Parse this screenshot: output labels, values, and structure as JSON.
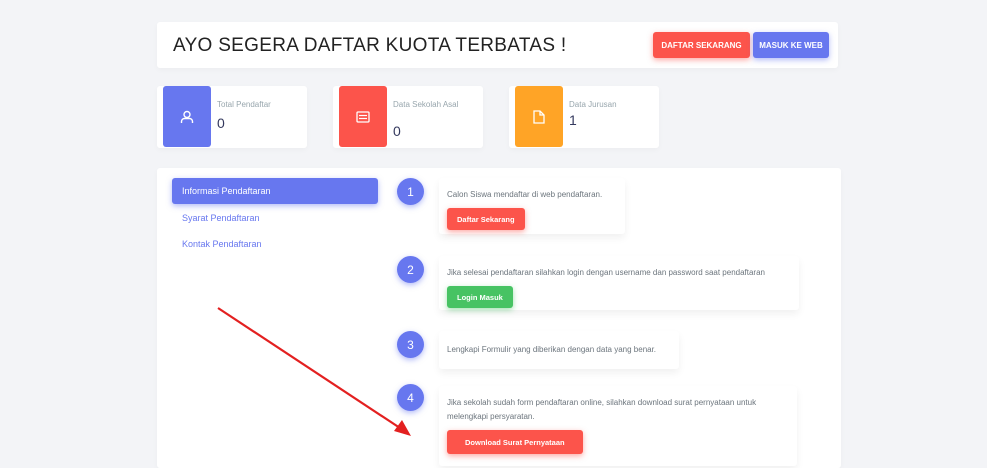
{
  "header": {
    "title": "AYO SEGERA DAFTAR KUOTA TERBATAS !",
    "daftar_button": "DAFTAR SEKARANG",
    "masuk_button": "MASUK KE WEB"
  },
  "stats": [
    {
      "label": "Total Pendaftar",
      "value": "0",
      "icon": "user-icon",
      "color": "#6777ef"
    },
    {
      "label": "Data Sekolah Asal",
      "value": "0",
      "icon": "school-card-icon",
      "color": "#fc544b"
    },
    {
      "label": "Data Jurusan",
      "value": "1",
      "icon": "file-icon",
      "color": "#ffa426"
    }
  ],
  "sidebar": {
    "items": [
      {
        "label": "Informasi Pendaftaran",
        "active": true
      },
      {
        "label": "Syarat Pendaftaran",
        "active": false
      },
      {
        "label": "Kontak Pendaftaran",
        "active": false
      }
    ]
  },
  "steps": [
    {
      "number": "1",
      "text": "Calon Siswa mendaftar di web pendaftaran.",
      "button": "Daftar Sekarang"
    },
    {
      "number": "2",
      "text": "Jika selesai pendaftaran silahkan login dengan username dan password saat pendaftaran",
      "button": "Login Masuk"
    },
    {
      "number": "3",
      "text": "Lengkapi Formulir yang diberikan dengan data yang benar."
    },
    {
      "number": "4",
      "text": "Jika sekolah sudah form pendaftaran online, silahkan download surat pernyataan untuk melengkapi persyaratan.",
      "button": "Download Surat Pernyataan"
    }
  ],
  "colors": {
    "primary": "#6777ef",
    "danger": "#fc544b",
    "success": "#47c363",
    "warning": "#ffa426",
    "annotation_arrow": "#e32020"
  }
}
